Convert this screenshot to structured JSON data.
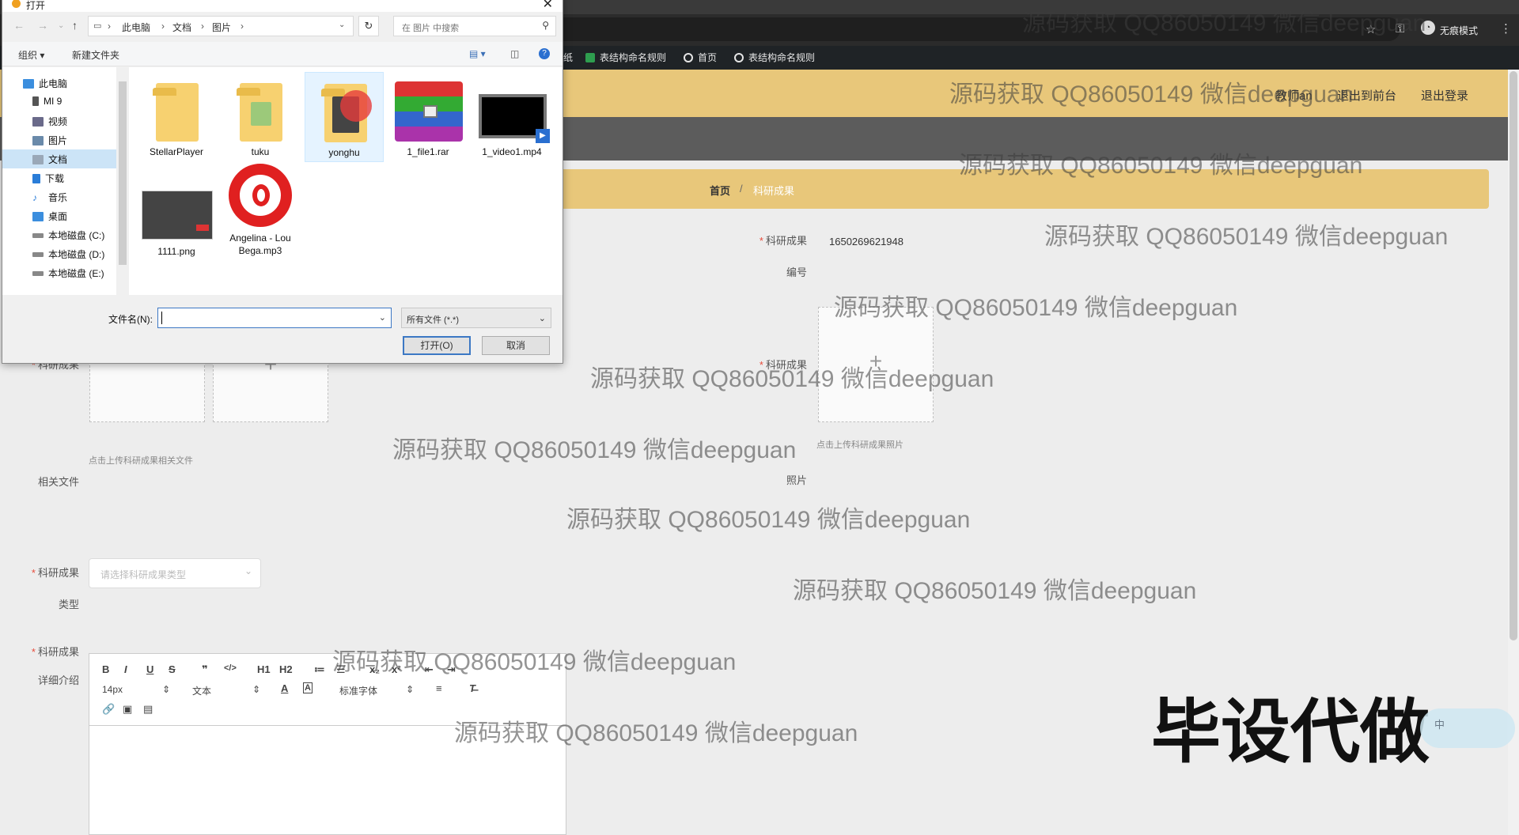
{
  "browser": {
    "mode_label": "无痕模式",
    "bookmarks": [
      {
        "label": "纸",
        "icon": "none"
      },
      {
        "label": "表结构命名规则",
        "icon": "sheet-icon"
      },
      {
        "label": "首页",
        "icon": "globe-icon"
      },
      {
        "label": "表结构命名规则",
        "icon": "globe-icon"
      }
    ]
  },
  "header": {
    "links": [
      "教师an",
      "退出到前台",
      "退出登录"
    ]
  },
  "breadcrumb": {
    "home": "首页",
    "sep": "/",
    "current": "科研成果"
  },
  "form": {
    "id_label_1": "科研成果",
    "id_label_2": "编号",
    "id_value": "1650269621948",
    "photo_label_1": "科研成果",
    "photo_label_2": "照片",
    "photo_hint": "点击上传科研成果照片",
    "files_label_1": "科研成果",
    "files_label_2": "相关文件",
    "files_hint": "点击上传科研成果相关文件",
    "type_label_1": "科研成果",
    "type_label_2": "类型",
    "type_placeholder": "请选择科研成果类型",
    "detail_label_1": "科研成果",
    "detail_label_2": "详细介绍",
    "upload_plus": "+",
    "editor": {
      "font_size": "14px",
      "block": "文本",
      "font": "标准字体",
      "buttons": [
        "B",
        "I",
        "U",
        "S",
        "❞",
        "</>",
        "H1",
        "H2",
        "≔",
        "☰",
        "x₂",
        "x²",
        "⇤",
        "⇥"
      ]
    }
  },
  "dialog": {
    "title": "打开",
    "path": [
      "此电脑",
      "文档",
      "图片"
    ],
    "search_placeholder": "在 图片 中搜索",
    "organize": "组织 ▾",
    "new_folder": "新建文件夹",
    "sidebar": [
      {
        "label": "此电脑",
        "color": "#3b8ede"
      },
      {
        "label": "MI 9",
        "color": "#555555"
      },
      {
        "label": "视频",
        "color": "#6a6a8a"
      },
      {
        "label": "图片",
        "color": "#6a8aaa"
      },
      {
        "label": "文档",
        "color": "#9aa8b8"
      },
      {
        "label": "下载",
        "color": "#2a7dd8"
      },
      {
        "label": "音乐",
        "color": "#2a7dd8"
      },
      {
        "label": "桌面",
        "color": "#3b8ede"
      },
      {
        "label": "本地磁盘 (C:)",
        "color": "#888888"
      },
      {
        "label": "本地磁盘 (D:)",
        "color": "#888888"
      },
      {
        "label": "本地磁盘 (E:)",
        "color": "#888888"
      }
    ],
    "files": [
      {
        "name": "StellarPlayer",
        "kind": "folder"
      },
      {
        "name": "tuku",
        "kind": "folder"
      },
      {
        "name": "yonghu",
        "kind": "folder"
      },
      {
        "name": "1_file1.rar",
        "kind": "rar"
      },
      {
        "name": "1_video1.mp4",
        "kind": "video"
      },
      {
        "name": "1111.png",
        "kind": "image"
      },
      {
        "name": "Angelina - Lou Bega.mp3",
        "kind": "audio"
      }
    ],
    "filename_label": "文件名(N):",
    "filename_value": "",
    "filetype": "所有文件 (*.*)",
    "open_button": "打开(O)",
    "cancel_button": "取消"
  },
  "watermark": "源码获取 QQ86050149 微信deepguan",
  "overlay_text": "毕设代做",
  "ime_label": "中"
}
